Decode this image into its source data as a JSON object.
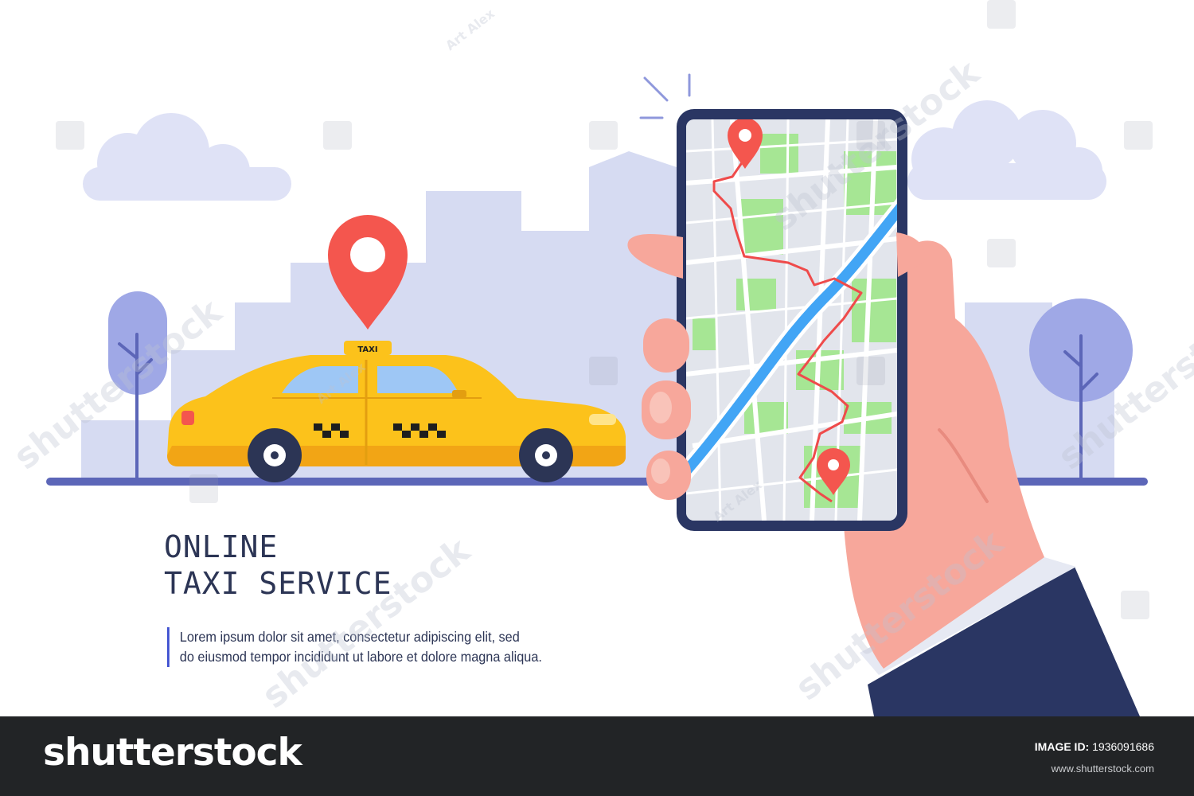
{
  "taxi_sign": "TAXI",
  "headline": {
    "line1": "ONLINE",
    "line2": "TAXI SERVICE"
  },
  "description": {
    "line1": "Lorem ipsum dolor sit amet, consectetur adipiscing elit, sed",
    "line2": "do eiusmod tempor incididunt ut labore et dolore magna aliqua."
  },
  "watermarks": {
    "brand": "shutterstock",
    "author": "Art Alex"
  },
  "footer": {
    "brand": "shutterstock",
    "image_id_label": "IMAGE ID:",
    "image_id": "1936091686",
    "site": "www.shutterstock.com"
  },
  "colors": {
    "taxi_yellow": "#fcc21b",
    "pin_red": "#f4564e",
    "skyline": "#d6dbf2",
    "tree": "#9fa8e6",
    "map_green": "#a6e694",
    "river": "#42a5f5",
    "route": "#ef4b4b",
    "sleeve": "#2a3663",
    "skin": "#f7a79b",
    "footer_bg": "#222426"
  }
}
